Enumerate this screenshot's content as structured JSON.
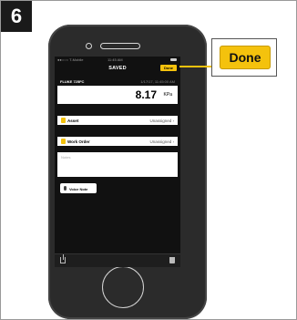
{
  "step": {
    "number": "6"
  },
  "status_bar": {
    "carrier": "●●○○○ T-Mobile",
    "time": "11:45 AM"
  },
  "nav": {
    "title": "SAVED",
    "done_label": "Done"
  },
  "reading": {
    "device": "FLUKE 725FC",
    "timestamp": "1/17/17, 11:45:00 AM",
    "value": "8.17",
    "unit": "KPa"
  },
  "rows": [
    {
      "label": "Asset",
      "value": "Unassigned ›"
    },
    {
      "label": "Work Order",
      "value": "Unassigned ›"
    }
  ],
  "notes": {
    "placeholder": "Notes"
  },
  "voice_note": {
    "label": "Voice Note"
  },
  "callout": {
    "label": "Done"
  },
  "colors": {
    "accent": "#f4c20d",
    "phone_body": "#2b2b2b",
    "screen_bg": "#111111"
  }
}
